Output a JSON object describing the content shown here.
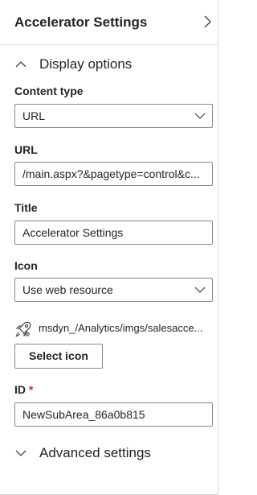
{
  "header": {
    "title": "Accelerator Settings",
    "chevron_icon": "chevron-right-icon"
  },
  "display_section": {
    "label": "Display options",
    "expanded": true,
    "icon": "chevron-up-icon"
  },
  "content_type": {
    "label": "Content type",
    "value": "URL"
  },
  "url": {
    "label": "URL",
    "value": "/main.aspx?&pagetype=control&c..."
  },
  "title": {
    "label": "Title",
    "value": "Accelerator Settings"
  },
  "icon": {
    "label": "Icon",
    "value": "Use web resource"
  },
  "web_resource": {
    "icon": "rocket-settings-icon",
    "path": "msdyn_/Analytics/imgs/salesacce..."
  },
  "select_icon_button": {
    "label": "Select icon"
  },
  "id_field": {
    "label": "ID",
    "required_mark": "*",
    "value": "NewSubArea_86a0b815"
  },
  "advanced_section": {
    "label": "Advanced settings",
    "expanded": false,
    "icon": "chevron-down-icon"
  },
  "colors": {
    "border": "#8a8886",
    "text": "#242424",
    "required": "#c4314b"
  }
}
